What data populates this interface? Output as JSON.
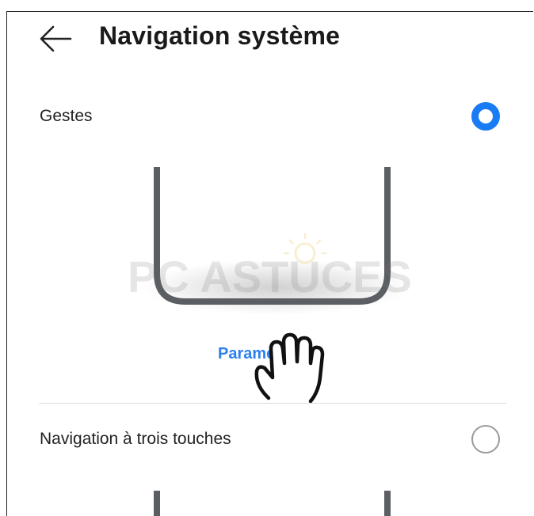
{
  "header": {
    "title": "Navigation système",
    "back_icon": "arrow-left-icon"
  },
  "options": [
    {
      "label": "Gestes",
      "selected": true
    },
    {
      "label": "Navigation à trois touches",
      "selected": false
    }
  ],
  "settings_link": "Paramètres",
  "watermark": "PC ASTUCES",
  "colors": {
    "accent": "#1a7cf5",
    "link": "#2d7ff0",
    "phone_outline": "#5b5e63"
  }
}
